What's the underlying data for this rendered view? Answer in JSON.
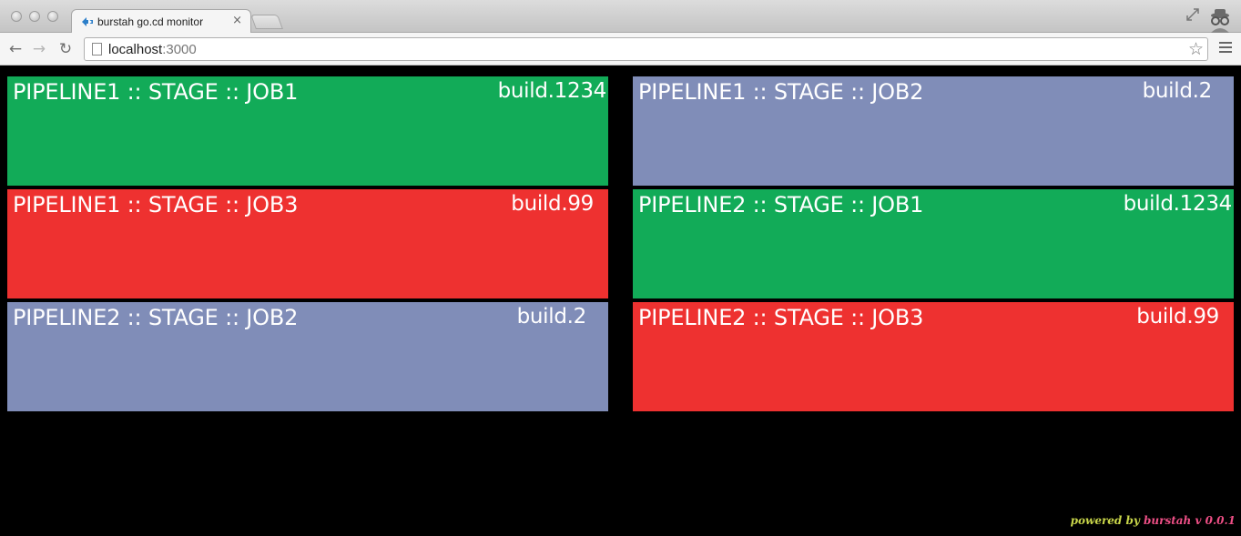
{
  "browser": {
    "tab_title": "burstah go.cd monitor",
    "tab_close": "×",
    "url_host": "localhost",
    "url_port": ":3000",
    "back_icon": "←",
    "forward_icon": "→",
    "reload_icon": "↻",
    "star_icon": "☆"
  },
  "colors": {
    "passed": "#12AB58",
    "failed": "#EE3130",
    "unknown": "#808DB8",
    "footer_powered": "#C9D64A",
    "footer_brand": "#EE4F86"
  },
  "jobs": [
    {
      "name": "PIPELINE1 :: STAGE :: JOB1",
      "build": "build.1234",
      "status": "passed"
    },
    {
      "name": "PIPELINE1 :: STAGE :: JOB2",
      "build": "build.2",
      "status": "unknown"
    },
    {
      "name": "PIPELINE1 :: STAGE :: JOB3",
      "build": "build.99",
      "status": "failed"
    },
    {
      "name": "PIPELINE2 :: STAGE :: JOB1",
      "build": "build.1234",
      "status": "passed"
    },
    {
      "name": "PIPELINE2 :: STAGE :: JOB2",
      "build": "build.2",
      "status": "unknown"
    },
    {
      "name": "PIPELINE2 :: STAGE :: JOB3",
      "build": "build.99",
      "status": "failed"
    }
  ],
  "footer": {
    "powered_by": "powered by",
    "brand": "burstah v 0.0.1"
  }
}
